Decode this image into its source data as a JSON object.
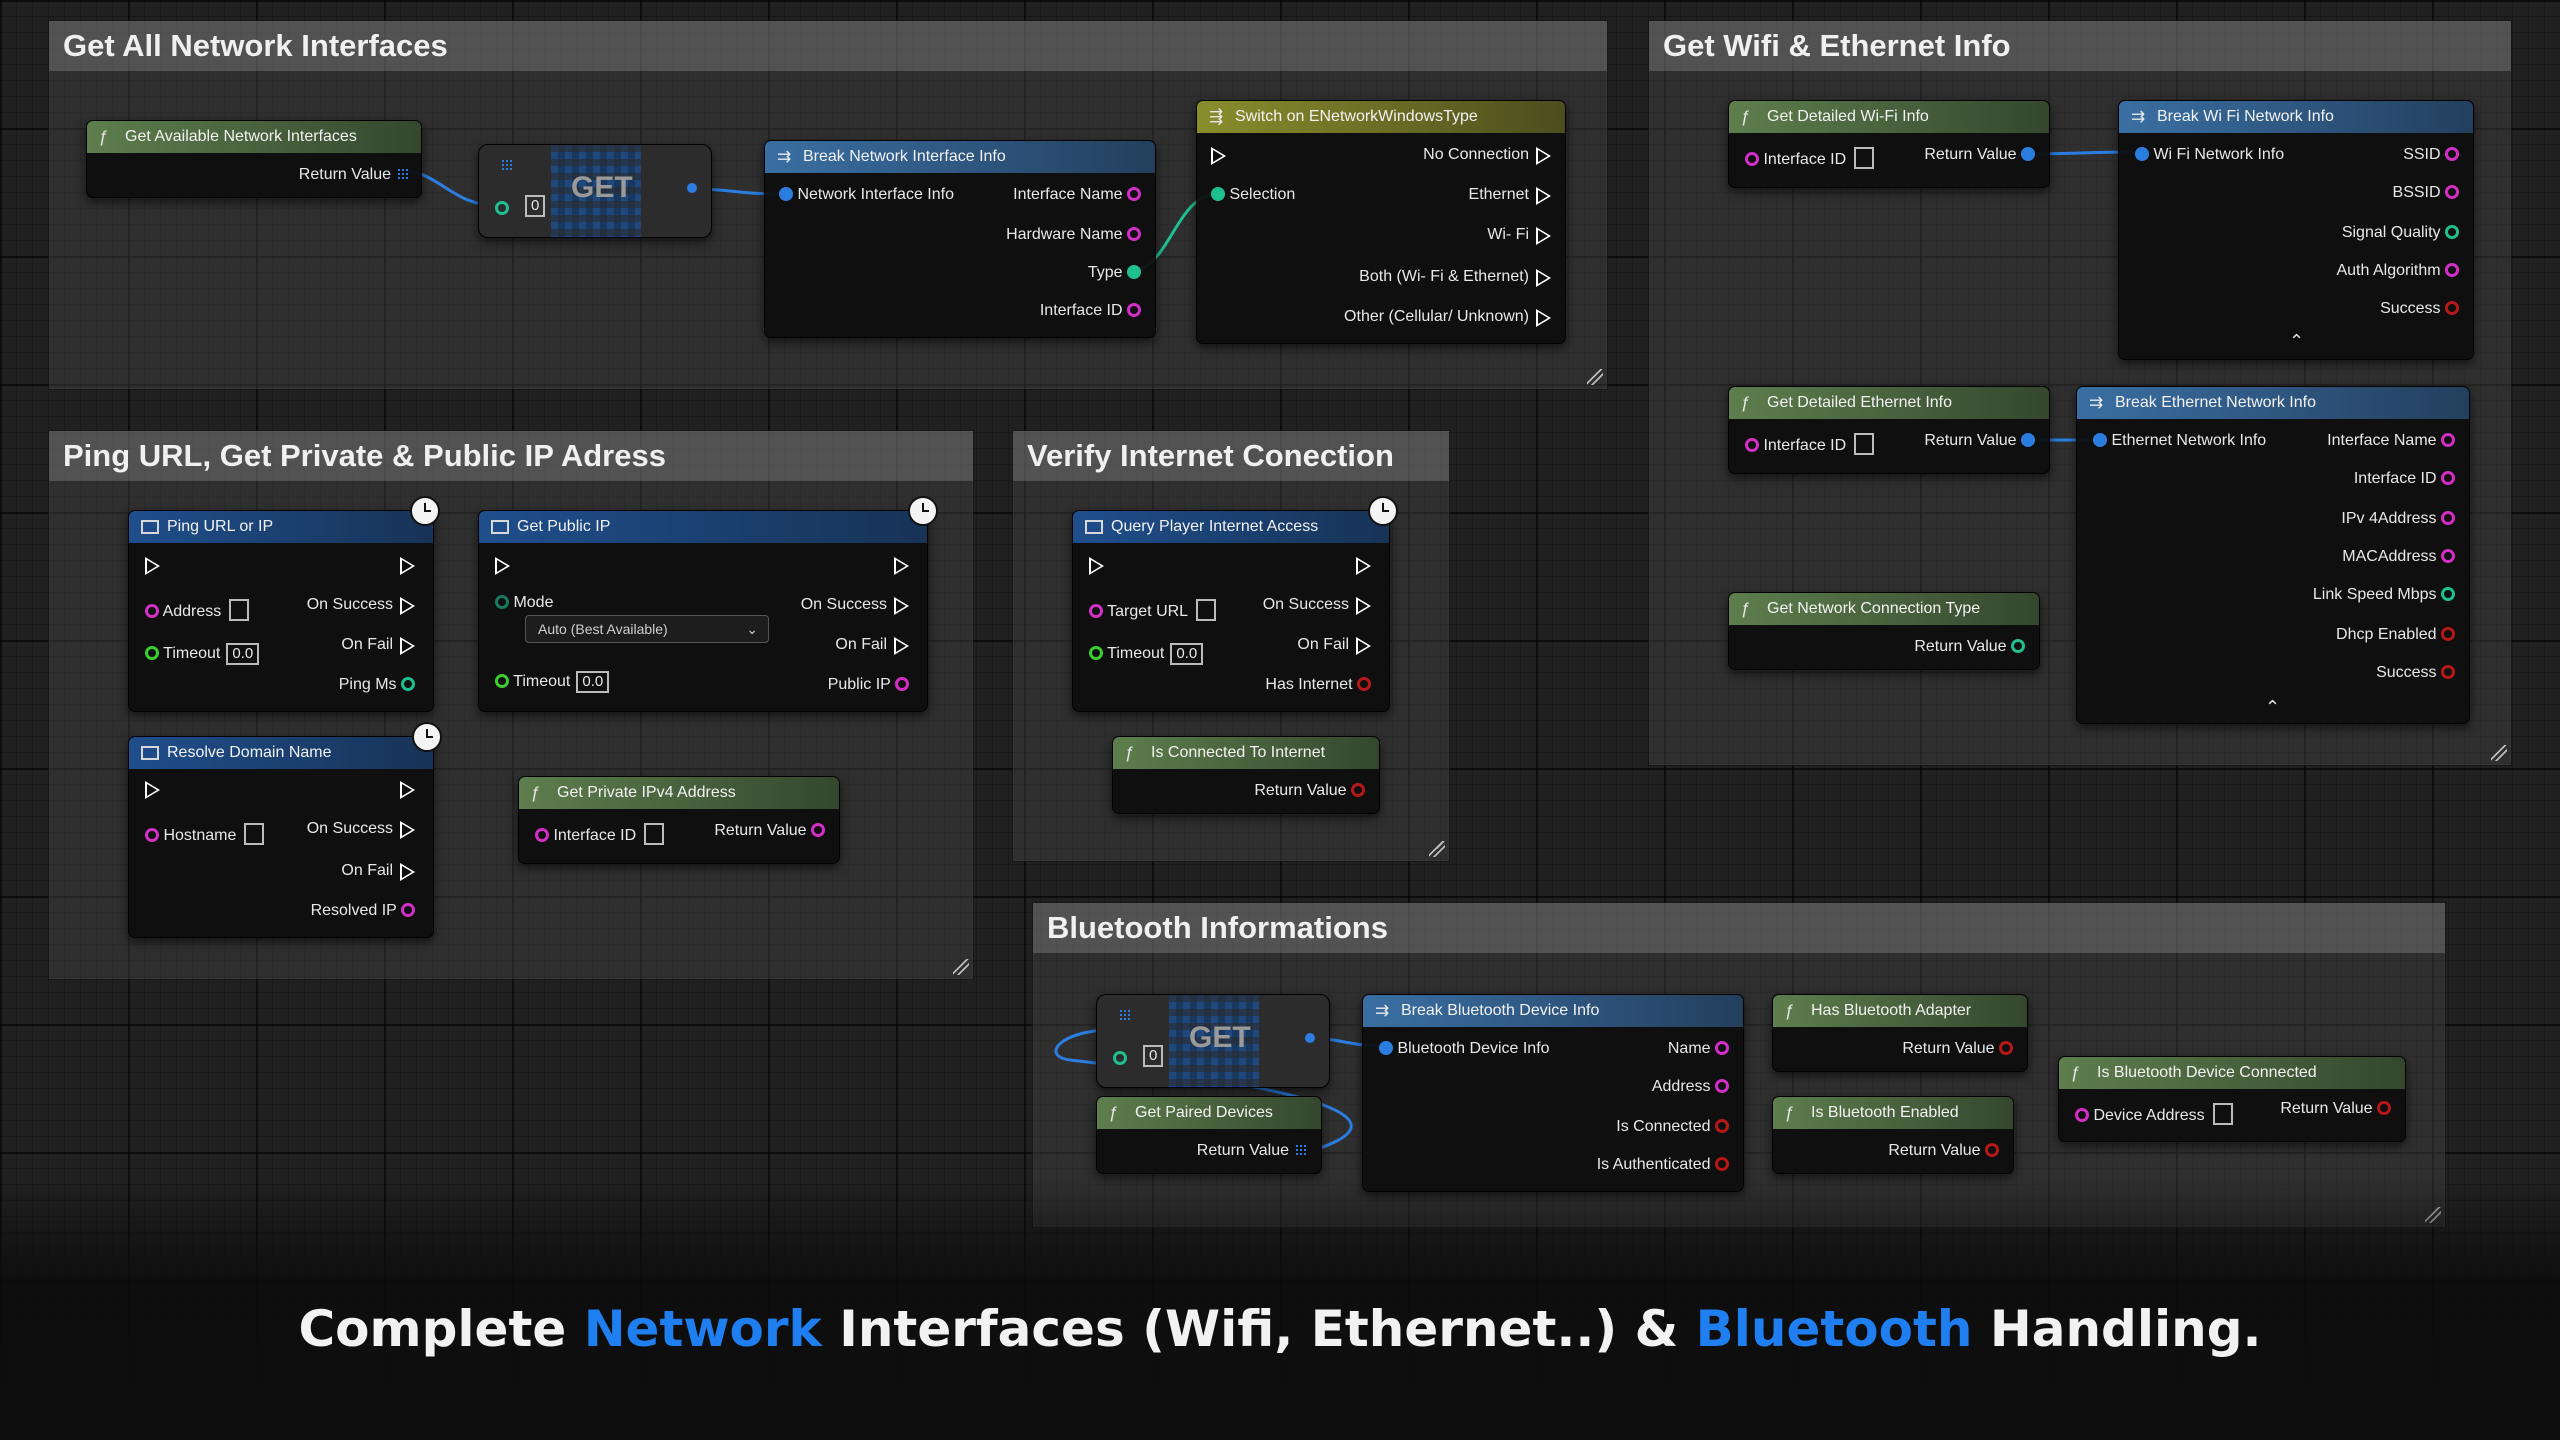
{
  "comments": {
    "all_interfaces": "Get All Network Interfaces",
    "wifi_ethernet": "Get Wifi & Ethernet Info",
    "ping": "Ping URL, Get Private & Public IP Adress",
    "verify": "Verify Internet Conection",
    "bluetooth": "Bluetooth Informations"
  },
  "nodes": {
    "get_available": {
      "title": "Get Available Network Interfaces",
      "return": "Return Value"
    },
    "get1": {
      "label": "GET",
      "index": "0"
    },
    "break_network": {
      "title": "Break Network Interface Info",
      "in": "Network Interface Info",
      "out": [
        "Interface Name",
        "Hardware Name",
        "Type",
        "Interface ID"
      ]
    },
    "switch": {
      "title": "Switch on ENetworkWindowsType",
      "selection": "Selection",
      "out": [
        "No Connection",
        "Ethernet",
        "Wi- Fi",
        "Both (Wi- Fi & Ethernet)",
        "Other (Cellular/ Unknown)"
      ]
    },
    "get_wifi": {
      "title": "Get Detailed Wi-Fi Info",
      "in": "Interface ID",
      "return": "Return Value"
    },
    "break_wifi": {
      "title": "Break Wi Fi Network Info",
      "in": "Wi Fi Network Info",
      "out": [
        "SSID",
        "BSSID",
        "Signal Quality",
        "Auth Algorithm",
        "Success"
      ]
    },
    "get_ethernet": {
      "title": "Get Detailed Ethernet Info",
      "in": "Interface ID",
      "return": "Return Value"
    },
    "break_ethernet": {
      "title": "Break Ethernet Network Info",
      "in": "Ethernet Network Info",
      "out": [
        "Interface Name",
        "Interface ID",
        "IPv 4Address",
        "MACAddress",
        "Link Speed Mbps",
        "Dhcp Enabled",
        "Success"
      ]
    },
    "get_conn_type": {
      "title": "Get Network Connection Type",
      "return": "Return Value"
    },
    "ping": {
      "title": "Ping URL or IP",
      "address": "Address",
      "timeout": "Timeout",
      "timeout_val": "0.0",
      "on_success": "On Success",
      "on_fail": "On Fail",
      "ping_ms": "Ping Ms"
    },
    "resolve": {
      "title": "Resolve Domain Name",
      "hostname": "Hostname",
      "on_success": "On Success",
      "on_fail": "On Fail",
      "resolved": "Resolved IP"
    },
    "public_ip": {
      "title": "Get Public IP",
      "mode": "Mode",
      "mode_val": "Auto (Best Available)",
      "timeout": "Timeout",
      "timeout_val": "0.0",
      "on_success": "On Success",
      "on_fail": "On Fail",
      "public": "Public IP"
    },
    "private_ip": {
      "title": "Get Private IPv4 Address",
      "in": "Interface ID",
      "return": "Return Value"
    },
    "query_access": {
      "title": "Query Player Internet Access",
      "target": "Target URL",
      "timeout": "Timeout",
      "timeout_val": "0.0",
      "on_success": "On Success",
      "on_fail": "On Fail",
      "has_internet": "Has Internet"
    },
    "is_connected": {
      "title": "Is Connected To Internet",
      "return": "Return Value"
    },
    "get2": {
      "label": "GET",
      "index": "0"
    },
    "paired": {
      "title": "Get Paired Devices",
      "return": "Return Value"
    },
    "break_bt": {
      "title": "Break Bluetooth Device Info",
      "in": "Bluetooth Device Info",
      "out": [
        "Name",
        "Address",
        "Is Connected",
        "Is Authenticated"
      ]
    },
    "has_adapter": {
      "title": "Has Bluetooth Adapter",
      "return": "Return Value"
    },
    "bt_enabled": {
      "title": "Is Bluetooth Enabled",
      "return": "Return Value"
    },
    "bt_connected": {
      "title": "Is Bluetooth Device Connected",
      "in": "Device Address",
      "return": "Return Value"
    }
  },
  "banner": {
    "pre": "Complete ",
    "w1": "Network",
    "mid": " Interfaces (Wifi, Ethernet..) & ",
    "w2": "Bluetooth",
    "post": " Handling."
  },
  "colors": {
    "string_pin": "#d22ec6",
    "int_pin": "#1fbf8f",
    "struct_pin": "#2b7de0",
    "bool_pin": "#b61818",
    "float_pin": "#3cce2e",
    "accent": "#1f7ff0"
  }
}
